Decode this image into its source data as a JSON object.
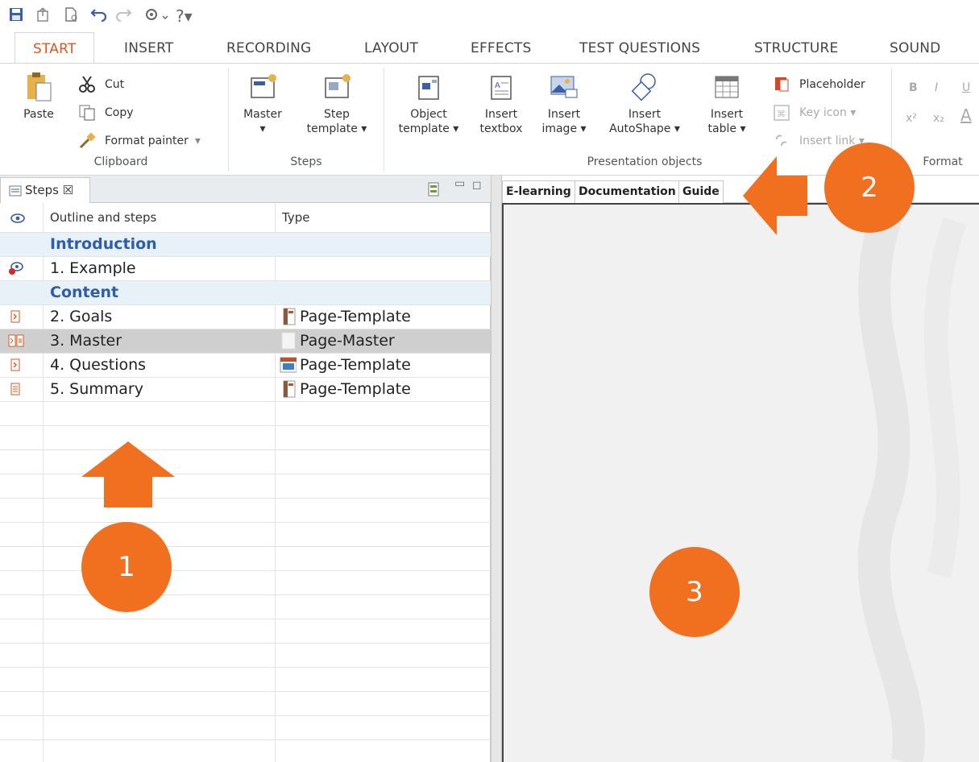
{
  "ribbon": {
    "tabs": [
      "START",
      "INSERT",
      "RECORDING",
      "LAYOUT",
      "EFFECTS",
      "TEST QUESTIONS",
      "STRUCTURE",
      "SOUND"
    ],
    "clipboard": {
      "paste": "Paste",
      "cut": "Cut",
      "copy": "Copy",
      "format_painter": "Format painter",
      "group_label": "Clipboard"
    },
    "steps": {
      "master_line1": "Master",
      "master_line2": "▾",
      "step_template_line1": "Step",
      "step_template_line2": "template ▾",
      "group_label": "Steps"
    },
    "presentation": {
      "object_template_line1": "Object",
      "object_template_line2": "template ▾",
      "insert_textbox_line1": "Insert",
      "insert_textbox_line2": "textbox",
      "insert_image_line1": "Insert",
      "insert_image_line2": "image ▾",
      "insert_autoshape_line1": "Insert",
      "insert_autoshape_line2": "AutoShape ▾",
      "insert_table_line1": "Insert",
      "insert_table_line2": "table ▾",
      "placeholder": "Placeholder",
      "key_icon": "Key icon ▾",
      "insert_link": "Insert link ▾",
      "group_label": "Presentation objects"
    },
    "format": {
      "bold": "B",
      "italic": "I",
      "underline": "U",
      "superscript": "x²",
      "subscript": "x₂",
      "font_color": "A",
      "group_label": "Format"
    }
  },
  "steps_panel": {
    "tab_label": "Steps ☒",
    "col_outline": "Outline and steps",
    "col_type": "Type",
    "rows": [
      {
        "text": "Introduction",
        "type": "",
        "kind": "section"
      },
      {
        "text": "1. Example",
        "type": "",
        "kind": "step"
      },
      {
        "text": "Content",
        "type": "",
        "kind": "section"
      },
      {
        "text": "2. Goals",
        "type": "Page-Template",
        "kind": "step"
      },
      {
        "text": "3. Master",
        "type": "Page-Master",
        "kind": "selected"
      },
      {
        "text": "4. Questions",
        "type": "Page-Template",
        "kind": "step"
      },
      {
        "text": "5. Summary",
        "type": "Page-Template",
        "kind": "step"
      }
    ]
  },
  "editor": {
    "tabs": [
      "E-learning",
      "Documentation",
      "Guide"
    ]
  },
  "callouts": [
    "1",
    "2",
    "3"
  ],
  "colors": {
    "accent": "#e2561c",
    "callout": "#f0701f",
    "section_text": "#2f5ea8",
    "section_bg": "#e8f0f8",
    "selected_bg": "#cfcfcf"
  }
}
